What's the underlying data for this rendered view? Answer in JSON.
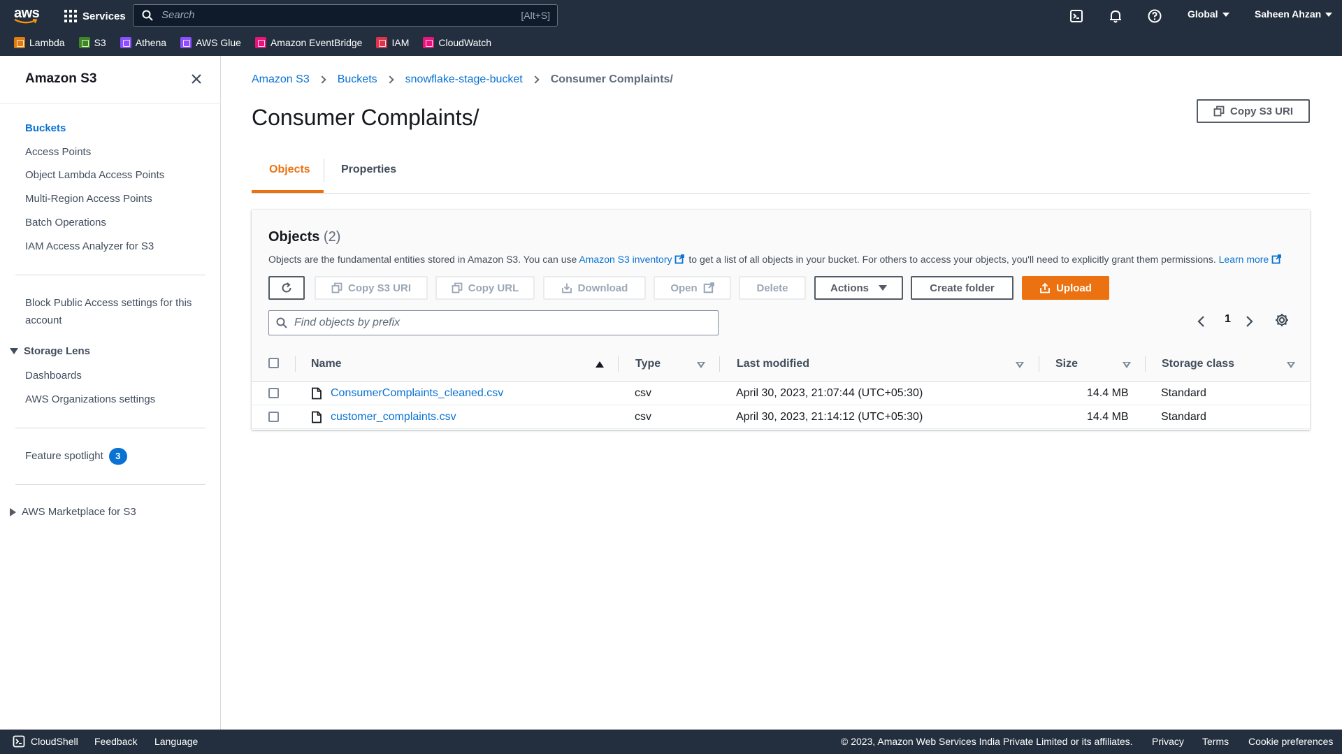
{
  "topnav": {
    "logo_text": "aws",
    "services_label": "Services",
    "search_placeholder": "Search",
    "search_shortcut": "[Alt+S]",
    "region_label": "Global",
    "user_label": "Saheen Ahzan",
    "icons": [
      "cloudshell-icon",
      "bell-icon",
      "help-icon"
    ],
    "favorites": [
      {
        "label": "Lambda",
        "color": "#e07b10"
      },
      {
        "label": "S3",
        "color": "#3f8624"
      },
      {
        "label": "Athena",
        "color": "#8c4fff"
      },
      {
        "label": "AWS Glue",
        "color": "#8c4fff"
      },
      {
        "label": "Amazon EventBridge",
        "color": "#e7157b"
      },
      {
        "label": "IAM",
        "color": "#dd344c"
      },
      {
        "label": "CloudWatch",
        "color": "#e7157b"
      }
    ]
  },
  "sidebar": {
    "title": "Amazon S3",
    "links": [
      "Buckets",
      "Access Points",
      "Object Lambda Access Points",
      "Multi-Region Access Points",
      "Batch Operations",
      "IAM Access Analyzer for S3"
    ],
    "block_public": "Block Public Access settings for this account",
    "storage_lens": "Storage Lens",
    "storage_lens_links": [
      "Dashboards",
      "AWS Organizations settings"
    ],
    "feature_spotlight": "Feature spotlight",
    "feature_count": "3",
    "marketplace": "AWS Marketplace for S3"
  },
  "breadcrumb": [
    "Amazon S3",
    "Buckets",
    "snowflake-stage-bucket",
    "Consumer Complaints/"
  ],
  "page_title": "Consumer Complaints/",
  "copy_s3_uri_label": "Copy S3 URI",
  "tabs": [
    "Objects",
    "Properties"
  ],
  "objects": {
    "title": "Objects",
    "count": "(2)",
    "desc_pre": "Objects are the fundamental entities stored in Amazon S3. You can use",
    "desc_link": "Amazon S3 inventory",
    "desc_post": "to get a list of all objects in your bucket. For others to access your objects, you'll need to explicitly grant them permissions.",
    "learn_more": "Learn more",
    "buttons": {
      "copy_s3_uri": "Copy S3 URI",
      "copy_url": "Copy URL",
      "download": "Download",
      "open": "Open",
      "delete": "Delete",
      "actions": "Actions",
      "create_folder": "Create folder",
      "upload": "Upload"
    },
    "filter_placeholder": "Find objects by prefix",
    "page_number": "1",
    "columns": [
      "Name",
      "Type",
      "Last modified",
      "Size",
      "Storage class"
    ],
    "rows": [
      {
        "name": "ConsumerComplaints_cleaned.csv",
        "type": "csv",
        "modified": "April 30, 2023, 21:07:44 (UTC+05:30)",
        "size": "14.4 MB",
        "storage": "Standard"
      },
      {
        "name": "customer_complaints.csv",
        "type": "csv",
        "modified": "April 30, 2023, 21:14:12 (UTC+05:30)",
        "size": "14.4 MB",
        "storage": "Standard"
      }
    ]
  },
  "footer": {
    "cloudshell": "CloudShell",
    "feedback": "Feedback",
    "language": "Language",
    "copyright": "© 2023, Amazon Web Services India Private Limited or its affiliates.",
    "privacy": "Privacy",
    "terms": "Terms",
    "cookie": "Cookie preferences"
  },
  "colors": {
    "accent": "#ec7211",
    "link": "#0972d3",
    "nav_bg": "#232f3e"
  }
}
